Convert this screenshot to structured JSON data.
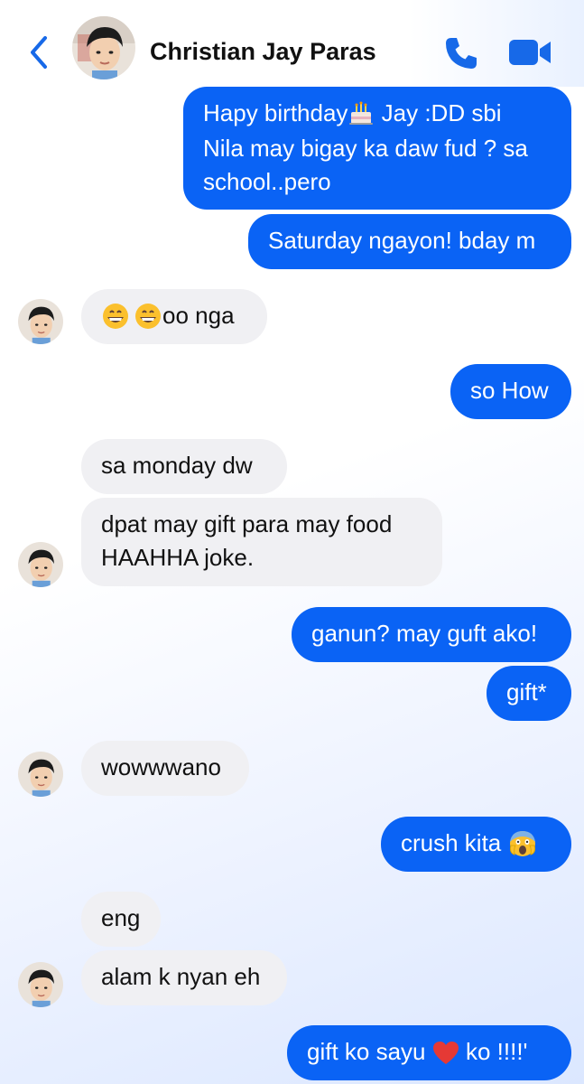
{
  "header": {
    "contact_name": "Christian Jay Paras"
  },
  "messages": [
    {
      "id": "m1",
      "from": "me",
      "text_a": "Hapy birthday",
      "text_b": " Jay :DD sbi\nNila may bigay ka daw fud ? sa\nschool..pero",
      "emoji": "birthday-cake-icon"
    },
    {
      "id": "m2",
      "from": "me",
      "text": "Saturday ngayon! bday m"
    },
    {
      "id": "m3",
      "from": "them",
      "text": "oo nga",
      "emoji": "grinning-face-icon"
    },
    {
      "id": "m4",
      "from": "me",
      "text": "so How"
    },
    {
      "id": "m5",
      "from": "them",
      "text": "sa monday dw"
    },
    {
      "id": "m6",
      "from": "them",
      "text": "dpat may gift para may food\nHAAHHA joke."
    },
    {
      "id": "m7",
      "from": "me",
      "text": "ganun? may guft ako!"
    },
    {
      "id": "m8",
      "from": "me",
      "text": "gift*"
    },
    {
      "id": "m9",
      "from": "them",
      "text": "wowwwano"
    },
    {
      "id": "m10",
      "from": "me",
      "text": "crush kita",
      "emoji": "screaming-face-icon"
    },
    {
      "id": "m11",
      "from": "them",
      "text": "eng"
    },
    {
      "id": "m12",
      "from": "them",
      "text": "alam k nyan eh"
    },
    {
      "id": "m13",
      "from": "me",
      "text_a": "gift ko sayu ",
      "text_b": " ko !!!!'",
      "emoji": "red-heart-icon"
    }
  ],
  "colors": {
    "outgoing_bubble": "#0a63f5",
    "incoming_bubble": "#f0f0f3",
    "accent": "#1769e8"
  }
}
